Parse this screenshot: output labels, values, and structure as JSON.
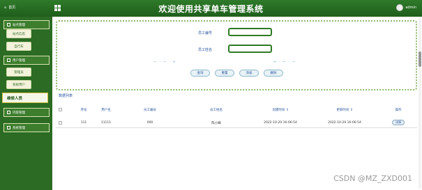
{
  "header": {
    "home_label": "首页",
    "title": "欢迎使用共享单车管理系统",
    "username": "admin"
  },
  "sidebar": {
    "groups": [
      {
        "label": "站点管理"
      },
      {
        "label": "用户管理"
      },
      {
        "label": "维修人员"
      },
      {
        "label": "内容管理"
      },
      {
        "label": "系统管理"
      }
    ],
    "sub_items": [
      {
        "label": "站点信息"
      },
      {
        "label": "自行车"
      },
      {
        "label": "管理员"
      },
      {
        "label": "系统用户"
      }
    ]
  },
  "search": {
    "fields": [
      {
        "label": "员工编号",
        "value": ""
      },
      {
        "label": "员工姓名",
        "value": ""
      }
    ],
    "buttons": [
      {
        "label": "查询"
      },
      {
        "label": "重置"
      },
      {
        "label": "添加"
      },
      {
        "label": "删除"
      }
    ]
  },
  "list": {
    "title": "数据列表",
    "columns": [
      "序号",
      "用户名",
      "员工编号",
      "员工姓名",
      "创建时间 ⇕",
      "更新时间 ⇕",
      "操作"
    ],
    "rows": [
      {
        "index": "111",
        "username": "11111",
        "employee_no": "000",
        "employee_name": "陈小峰",
        "created": "2022-10-20 16:06:54",
        "updated": "2022-10-20 16:06:54",
        "action": "详情"
      }
    ]
  },
  "watermark": "CSDN @MZ_ZXD001"
}
